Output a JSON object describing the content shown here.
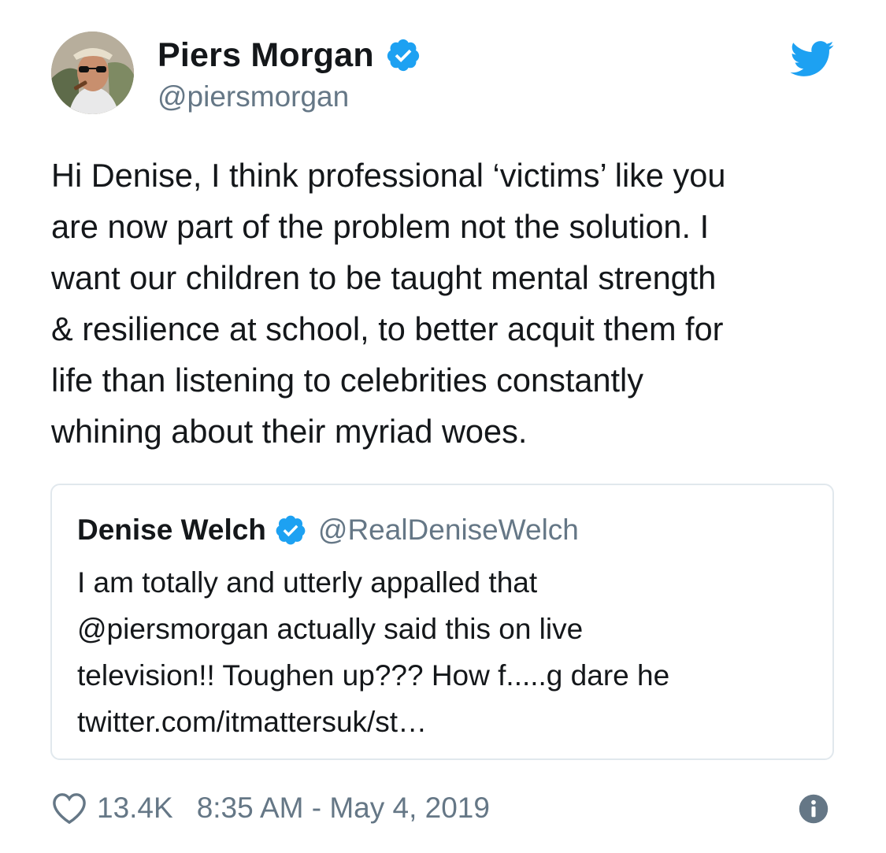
{
  "tweet": {
    "author": {
      "display_name": "Piers Morgan",
      "handle": "@piersmorgan",
      "verified": true
    },
    "text": "Hi Denise, I think professional ‘victims’ like you\nare now part of the problem not the solution. I\nwant our children to be taught mental strength\n& resilience at school, to better acquit them for\nlife than listening to celebrities constantly\nwhining about their myriad woes.",
    "quoted_tweet": {
      "display_name": "Denise Welch",
      "handle": "@RealDeniseWelch",
      "verified": true,
      "text": "I am totally and utterly appalled that\n@piersmorgan actually said this on live\ntelevision!! Toughen up??? How f.....g dare he\ntwitter.com/itmattersuk/st…"
    },
    "likes": "13.4K",
    "timestamp": "8:35 AM - May 4, 2019"
  },
  "icons": {
    "logo": "twitter-bird-icon",
    "verified": "verified-badge-icon",
    "like": "heart-icon",
    "info": "info-icon"
  },
  "colors": {
    "brand": "#1da1f2",
    "text": "#14171a",
    "secondary": "#657786",
    "border": "#e1e8ed"
  }
}
